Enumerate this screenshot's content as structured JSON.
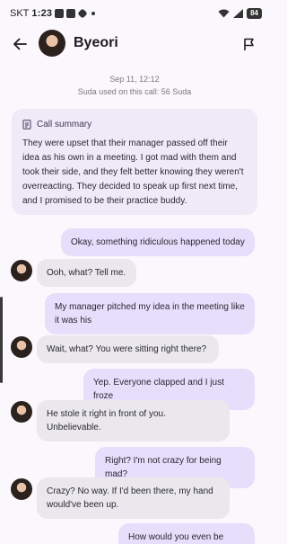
{
  "status_bar": {
    "carrier": "SKT",
    "time": "1:23",
    "battery": "84"
  },
  "header": {
    "name": "Byeori"
  },
  "meta": {
    "date": "Sep 11, 12:12",
    "usage": "Suda used on this call: 56 Suda"
  },
  "summary": {
    "title": "Call summary",
    "text": "They were upset that their manager passed off their idea as his own in a meeting. I got mad with them and took their side, and they felt better knowing they weren't overreacting. They decided to speak up first next time, and I promised to be their practice buddy."
  },
  "messages": [
    {
      "from": "me",
      "text": "Okay, something ridiculous happened today"
    },
    {
      "from": "them",
      "text": "Ooh, what? Tell me."
    },
    {
      "from": "me",
      "text": "My manager pitched my idea in the meeting like it was his"
    },
    {
      "from": "them",
      "text": "Wait, what? You were sitting right there?"
    },
    {
      "from": "me",
      "text": "Yep. Everyone clapped and I just froze"
    },
    {
      "from": "them",
      "text": "He stole it right in front of you. Unbelievable."
    },
    {
      "from": "me",
      "text": "Right? I'm not crazy for being mad?"
    },
    {
      "from": "them",
      "text": "Crazy? No way. If I'd been there, my hand would've been up."
    },
    {
      "from": "me",
      "text": "How would you even be there"
    }
  ],
  "colors": {
    "bubble_me": "#e6dffb",
    "bubble_them": "#eae8ed",
    "summary_bg": "#efeaf8",
    "background": "#fbf8fd"
  }
}
